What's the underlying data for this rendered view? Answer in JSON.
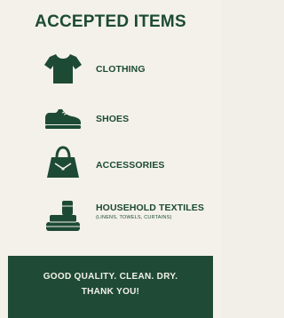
{
  "title": "ACCEPTED ITEMS",
  "items": [
    {
      "label": "CLOTHING",
      "icon": "tshirt-icon"
    },
    {
      "label": "SHOES",
      "icon": "shoe-icon"
    },
    {
      "label": "ACCESSORIES",
      "icon": "handbag-icon"
    },
    {
      "label": "HOUSEHOLD TEXTILES",
      "sublabel": "(LINENS, TOWELS, CURTAINS)",
      "icon": "folded-textiles-icon"
    }
  ],
  "footer": {
    "line1": "GOOD QUALITY. CLEAN. DRY.",
    "line2": "THANK YOU!"
  },
  "colors": {
    "background": "#f3f1ea",
    "accent": "#1f4a35"
  }
}
